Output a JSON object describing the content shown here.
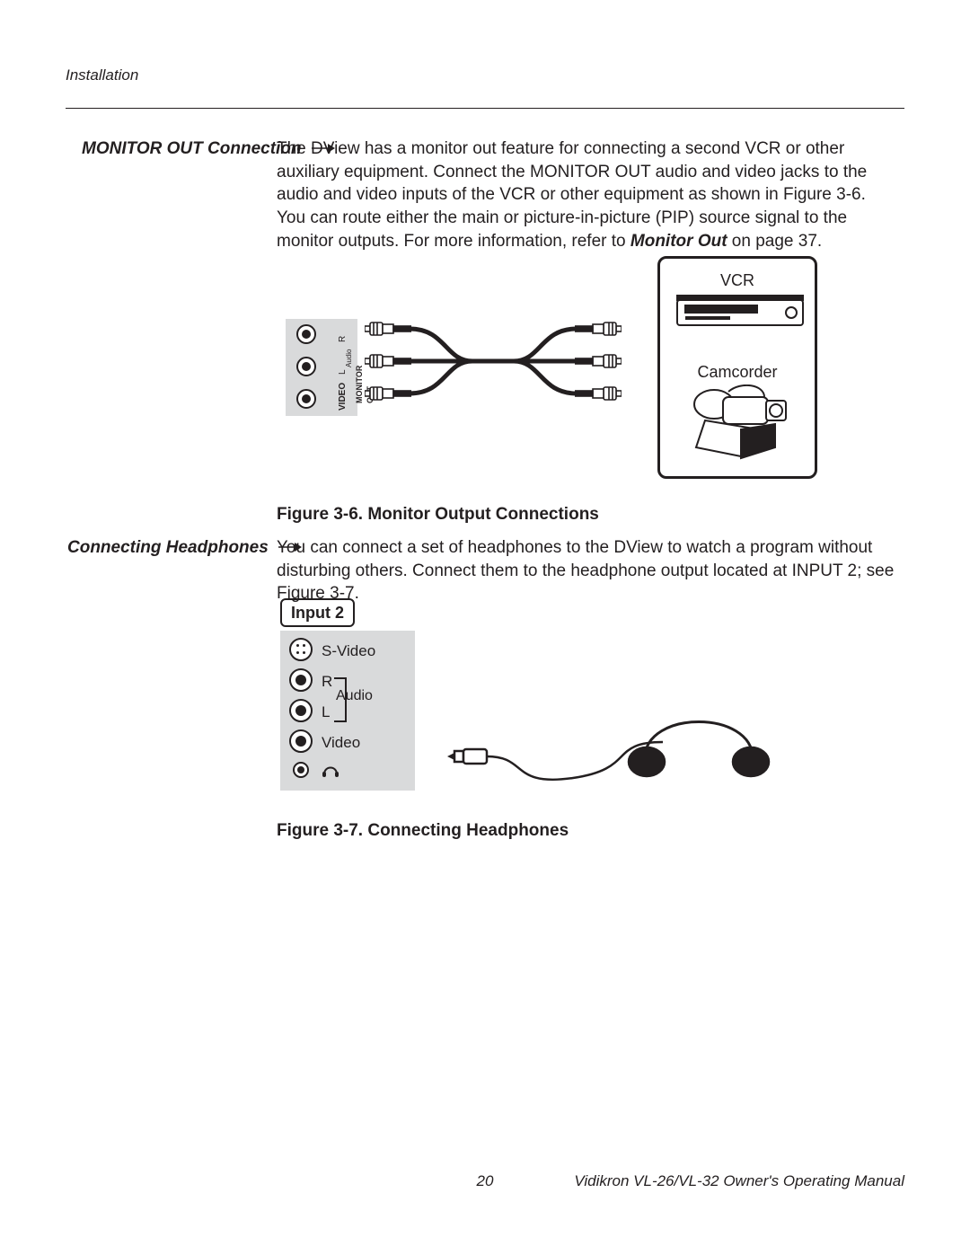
{
  "header": {
    "section": "Installation"
  },
  "section1": {
    "heading": "MONITOR OUT Connection",
    "para1a": "The DView has a monitor out feature for connecting a second VCR or other auxiliary equipment. Connect the MONITOR OUT audio and video jacks to the audio and video inputs of the VCR or other equipment as shown in Figure 3-6.",
    "para2a": "You can route either the main or picture-in-picture (PIP) source signal to the monitor outputs. For more information, refer to ",
    "para2b": "Monitor Out",
    "para2c": " on page 37."
  },
  "section2": {
    "heading": "Connecting Headphones",
    "para1": "You can connect a set of headphones to the DView to watch a program without disturbing others. Connect them to the headphone output located at INPUT 2; see Figure 3-7."
  },
  "fig36": {
    "caption": "Figure 3-6. Monitor Output Connections",
    "panel": {
      "R": "R",
      "L": "L",
      "VIDEO": "VIDEO",
      "Audio": "Audio",
      "MONOUT": "MONITOR OUT"
    },
    "devices": {
      "vcr": "VCR",
      "camcorder": "Camcorder"
    }
  },
  "fig37": {
    "caption": "Figure 3-7. Connecting Headphones",
    "input2": "Input 2",
    "labels": {
      "svideo": "S-Video",
      "R": "R",
      "Audio": "Audio",
      "L": "L",
      "Video": "Video"
    }
  },
  "footer": {
    "page": "20",
    "manual": "Vidikron VL-26/VL-32 Owner's Operating Manual"
  }
}
